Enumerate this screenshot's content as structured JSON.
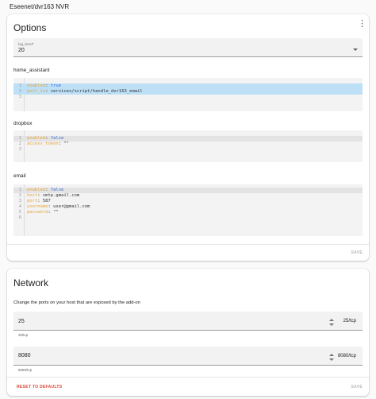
{
  "window": {
    "title": "Eseenet/dvr163 NVR"
  },
  "options": {
    "title": "Options",
    "menu_icon": "more-vertical-icon",
    "log_level": {
      "label": "log_level*",
      "value": "20"
    },
    "home_assistant": {
      "label": "home_assistant",
      "lines": [
        {
          "num": "1",
          "key": "enabled",
          "sep": ": ",
          "val": "true",
          "type": "bool"
        },
        {
          "num": "2",
          "key": "post_to",
          "sep": ": ",
          "val": "services/script/handle_dvr163_email",
          "type": "str"
        },
        {
          "num": "3",
          "key": "",
          "sep": "",
          "val": "",
          "type": "none"
        }
      ]
    },
    "dropbox": {
      "label": "dropbox",
      "lines": [
        {
          "num": "1",
          "key": "enabled",
          "sep": ": ",
          "val": "false",
          "type": "bool"
        },
        {
          "num": "2",
          "key": "access_token",
          "sep": ": ",
          "val": "\"\"",
          "type": "str"
        },
        {
          "num": "3",
          "key": "",
          "sep": "",
          "val": "",
          "type": "none"
        }
      ]
    },
    "email": {
      "label": "email",
      "lines": [
        {
          "num": "1",
          "key": "enabled",
          "sep": ": ",
          "val": "false",
          "type": "bool"
        },
        {
          "num": "2",
          "key": "host",
          "sep": ": ",
          "val": "smtp.gmail.com",
          "type": "str"
        },
        {
          "num": "3",
          "key": "port",
          "sep": ": ",
          "val": "587",
          "type": "str"
        },
        {
          "num": "4",
          "key": "username",
          "sep": ": ",
          "val": "user@gmail.com",
          "type": "str"
        },
        {
          "num": "5",
          "key": "password",
          "sep": ": ",
          "val": "\"\"",
          "type": "str"
        },
        {
          "num": "6",
          "key": "",
          "sep": "",
          "val": "",
          "type": "none"
        }
      ]
    },
    "save_label": "SAVE"
  },
  "network": {
    "title": "Network",
    "description": "Change the ports on your host that are exposed by the add-on",
    "ports": [
      {
        "value": "25",
        "suffix": "25/tcp",
        "helper": "25/tcp"
      },
      {
        "value": "8080",
        "suffix": "8080/tcp",
        "helper": "8080/tcp"
      }
    ],
    "reset_label": "RESET TO DEFAULTS",
    "save_label": "SAVE"
  },
  "colors": {
    "yaml_key": "#e8a53a",
    "yaml_bool": "#3b6bd6",
    "highlight": "#bde0f7",
    "reset": "#db4437",
    "disabled": "#b8b8b8"
  }
}
